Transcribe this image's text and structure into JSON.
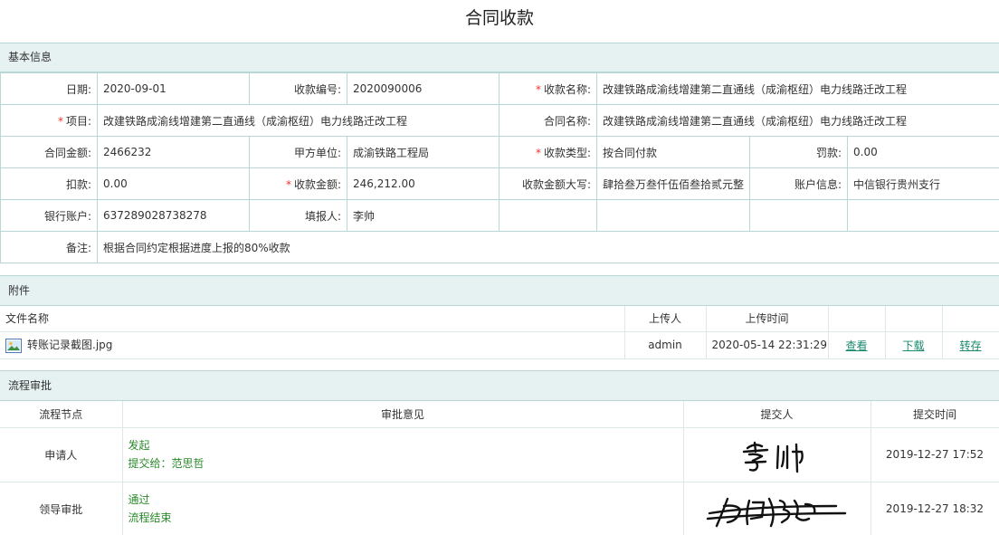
{
  "page": {
    "title": "合同收款"
  },
  "basic": {
    "section_title": "基本信息",
    "date_label": "日期:",
    "date_value": "2020-09-01",
    "receipt_no_label": "收款编号:",
    "receipt_no_value": "2020090006",
    "receipt_name_label": "收款名称:",
    "receipt_name_value": "改建铁路成渝线增建第二直通线（成渝枢纽）电力线路迁改工程",
    "project_label": "项目:",
    "project_value": "改建铁路成渝线增建第二直通线（成渝枢纽）电力线路迁改工程",
    "contract_name_label": "合同名称:",
    "contract_name_value": "改建铁路成渝线增建第二直通线（成渝枢纽）电力线路迁改工程",
    "contract_amount_label": "合同金额:",
    "contract_amount_value": "2466232",
    "party_a_label": "甲方单位:",
    "party_a_value": "成渝铁路工程局",
    "receipt_type_label": "收款类型:",
    "receipt_type_value": "按合同付款",
    "penalty_label": "罚款:",
    "penalty_value": "0.00",
    "deduction_label": "扣款:",
    "deduction_value": "0.00",
    "receipt_amount_label": "收款金额:",
    "receipt_amount_value": "246,212.00",
    "amount_upper_label": "收款金额大写:",
    "amount_upper_value": "肆拾叁万叁仟伍佰叁拾贰元整",
    "account_info_label": "账户信息:",
    "account_info_value": "中信银行贵州支行",
    "bank_account_label": "银行账户:",
    "bank_account_value": "637289028738278",
    "reporter_label": "填报人:",
    "reporter_value": "李帅",
    "remark_label": "备注:",
    "remark_value": "根据合同约定根据进度上报的80%收款",
    "required_mark": "*"
  },
  "attachments": {
    "section_title": "附件",
    "headers": {
      "file_name": "文件名称",
      "uploader": "上传人",
      "upload_time": "上传时间"
    },
    "rows": [
      {
        "file_name": "转账记录截图.jpg",
        "uploader": "admin",
        "upload_time": "2020-05-14 22:31:29",
        "view": "查看",
        "download": "下载",
        "save": "转存"
      }
    ]
  },
  "flow": {
    "section_title": "流程审批",
    "headers": {
      "node": "流程节点",
      "opinion": "审批意见",
      "submitter": "提交人",
      "time": "提交时间"
    },
    "rows": [
      {
        "node": "申请人",
        "opinion_1": "发起",
        "opinion_2": "提交给：范思哲",
        "time": "2019-12-27 17:52"
      },
      {
        "node": "领导审批",
        "opinion_1": "通过",
        "opinion_2": "流程结束",
        "time": "2019-12-27 18:32"
      }
    ]
  },
  "colors": {
    "section_bg": "#e6f1f1",
    "border": "#b8d6d6",
    "link": "#1a8a6e",
    "flow_text": "#2a8a2a",
    "required": "#e33333"
  },
  "icons": {
    "attachment_file": "image-file-icon"
  }
}
